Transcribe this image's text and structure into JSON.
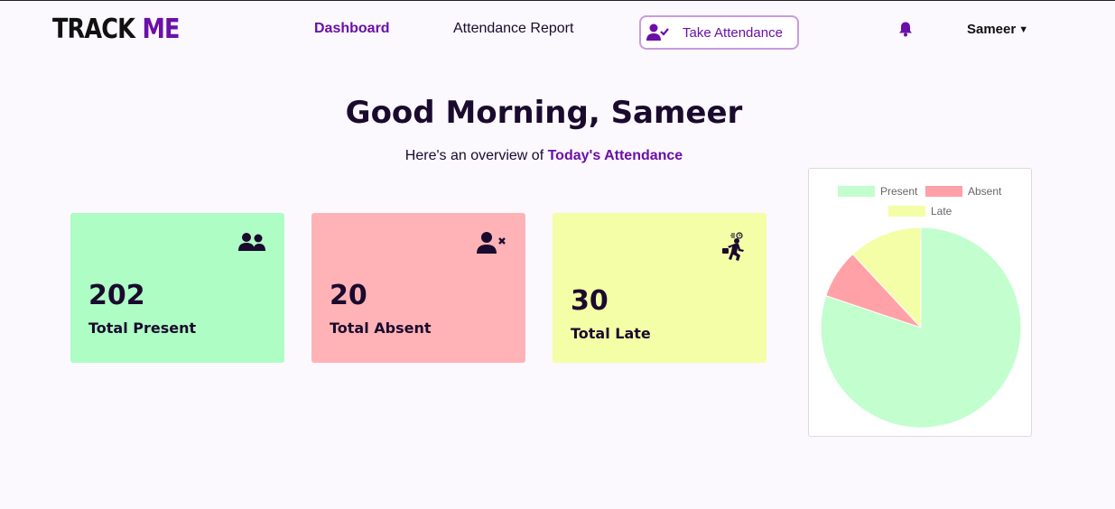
{
  "brand": {
    "part1": "TRACK",
    "part2": "ME"
  },
  "nav": {
    "dashboard": "Dashboard",
    "report": "Attendance Report",
    "take_attendance": "Take Attendance",
    "user": "Sameer"
  },
  "header": {
    "greeting": "Good Morning, Sameer",
    "subtitle_prefix": "Here's an overview of",
    "subtitle_highlight": "Today's Attendance"
  },
  "cards": {
    "present": {
      "value": "202",
      "label": "Total Present",
      "icon": "users-icon",
      "color": "#adfdc4"
    },
    "absent": {
      "value": "20",
      "label": "Total Absent",
      "icon": "user-x-icon",
      "color": "#ffb3b6"
    },
    "late": {
      "value": "30",
      "label": "Total Late",
      "icon": "running-late-icon",
      "color": "#f4fea6"
    }
  },
  "colors": {
    "accent": "#6b0fa8",
    "text": "#1a0a2e"
  },
  "chart_data": {
    "type": "pie",
    "categories": [
      "Present",
      "Absent",
      "Late"
    ],
    "values": [
      202,
      20,
      30
    ],
    "colors": [
      "#c2fece",
      "#ffa1a6",
      "#f3fea6"
    ],
    "legend": "top"
  }
}
